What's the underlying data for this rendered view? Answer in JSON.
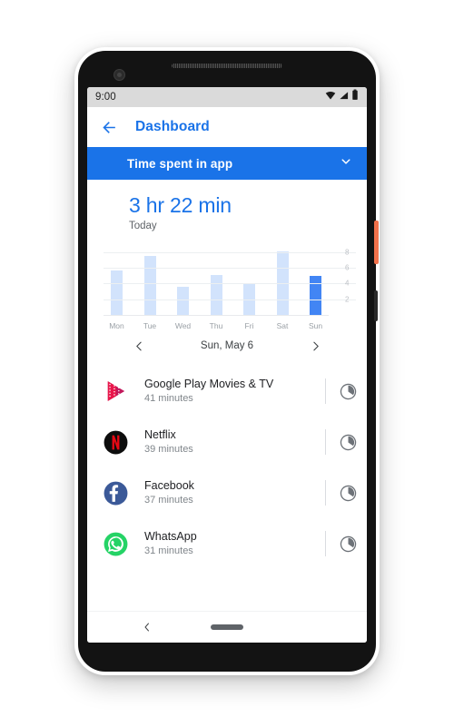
{
  "device": {
    "power_button_color": "#f2714b",
    "body_color": "#131313"
  },
  "status_bar": {
    "time": "9:00",
    "icons": [
      "wifi-icon",
      "signal-icon",
      "battery-icon"
    ]
  },
  "app_bar": {
    "back_icon": "back-arrow-icon",
    "title": "Dashboard",
    "title_color": "#1a73e8"
  },
  "section_header": {
    "title": "Time spent in app",
    "expand_icon": "chevron-down-icon",
    "background_color": "#1a73e8"
  },
  "summary": {
    "value": "3 hr 22 min",
    "label": "Today",
    "value_color": "#1a73e8"
  },
  "chart_data": {
    "type": "bar",
    "title": "Time spent in app",
    "categories": [
      "Mon",
      "Tue",
      "Wed",
      "Thu",
      "Fri",
      "Sat",
      "Sun"
    ],
    "values": [
      5.7,
      7.5,
      3.6,
      5.1,
      3.9,
      8.1,
      5.0
    ],
    "highlighted_index": 6,
    "xlabel": "",
    "ylabel": "",
    "ylim": [
      0,
      9
    ],
    "yticks": [
      2,
      4,
      6,
      8
    ],
    "ytick_labels": [
      "2",
      "4",
      "6",
      "8"
    ],
    "grid": true,
    "legend": false,
    "bar_color": "#d2e3fc",
    "highlight_color": "#4285f4",
    "gridline_color": "#eceff1",
    "tick_label_color": "#bdc1c6",
    "category_label_color": "#9aa0a6"
  },
  "date_nav": {
    "prev_icon": "chevron-left-icon",
    "next_icon": "chevron-right-icon",
    "current": "Sun, May 6"
  },
  "app_list": {
    "items": [
      {
        "icon": "google-play-movies-icon",
        "name": "Google Play Movies & TV",
        "time": "41 minutes",
        "action_icon": "timer-icon"
      },
      {
        "icon": "netflix-icon",
        "name": "Netflix",
        "time": "39 minutes",
        "action_icon": "timer-icon"
      },
      {
        "icon": "facebook-icon",
        "name": "Facebook",
        "time": "37 minutes",
        "action_icon": "timer-icon"
      },
      {
        "icon": "whatsapp-icon",
        "name": "WhatsApp",
        "time": "31 minutes",
        "action_icon": "timer-icon"
      }
    ]
  },
  "nav_bar": {
    "back_icon": "nav-back-icon",
    "home_pill": "home-pill-handle"
  }
}
